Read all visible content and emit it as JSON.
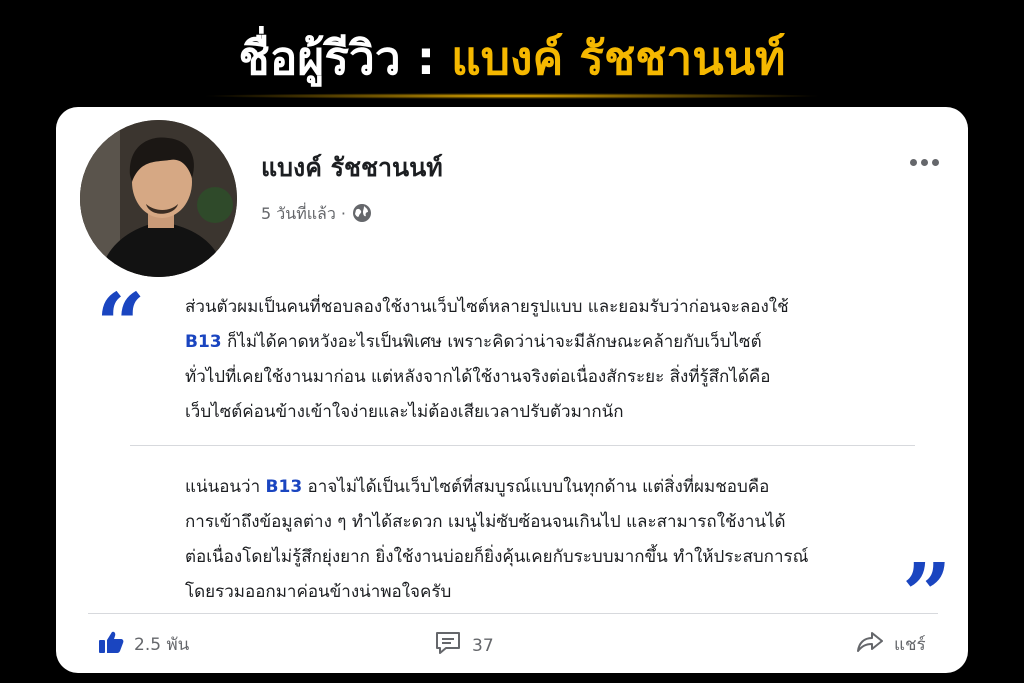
{
  "banner": {
    "prefix": "ชื่อผู้รีวิว : ",
    "name": "แบงค์ รัชชานนท์"
  },
  "post": {
    "author": "แบงค์ รัชชานนท์",
    "time": "5 วันที่แล้ว ·",
    "paragraph1": [
      {
        "pre": "ส่วนตัวผมเป็นคนที่ชอบลองใช้งานเว็บไซต์หลายรูปแบบ และยอมรับว่าก่อนจะลองใช้",
        "brand": "",
        "post": ""
      },
      {
        "pre": "",
        "brand": "B13",
        "post": " ก็ไม่ได้คาดหวังอะไรเป็นพิเศษ เพราะคิดว่าน่าจะมีลักษณะคล้ายกับเว็บไซต์"
      },
      {
        "pre": "ทั่วไปที่เคยใช้งานมาก่อน แต่หลังจากได้ใช้งานจริงต่อเนื่องสักระยะ สิ่งที่รู้สึกได้คือ",
        "brand": "",
        "post": ""
      },
      {
        "pre": "เว็บไซต์ค่อนข้างเข้าใจง่ายและไม่ต้องเสียเวลาปรับตัวมากนัก",
        "brand": "",
        "post": ""
      }
    ],
    "paragraph2": [
      {
        "pre": "แน่นอนว่า ",
        "brand": "B13",
        "post": " อาจไม่ได้เป็นเว็บไซต์ที่สมบูรณ์แบบในทุกด้าน แต่สิ่งที่ผมชอบคือ"
      },
      {
        "pre": "การเข้าถึงข้อมูลต่าง ๆ ทำได้สะดวก เมนูไม่ซับซ้อนจนเกินไป และสามารถใช้งานได้",
        "brand": "",
        "post": ""
      },
      {
        "pre": "ต่อเนื่องโดยไม่รู้สึกยุ่งยาก ยิ่งใช้งานบ่อยก็ยิ่งคุ้นเคยกับระบบมากขึ้น ทำให้ประสบการณ์",
        "brand": "",
        "post": ""
      },
      {
        "pre": "โดยรวมออกมาค่อนข้างน่าพอใจครับ",
        "brand": "",
        "post": ""
      }
    ]
  },
  "actions": {
    "likes": "2.5 พัน",
    "comments": "37",
    "share": "แชร์"
  },
  "icons": {
    "like": "thumbs-up-icon",
    "comment": "comment-icon",
    "share": "share-icon",
    "globe": "globe-icon",
    "more": "more-dots-icon",
    "quote_open": "quote-open-icon",
    "quote_close": "quote-close-icon"
  },
  "colors": {
    "accent": "#f5b800",
    "brand": "#1a45c0",
    "like": "#1a45c0"
  }
}
